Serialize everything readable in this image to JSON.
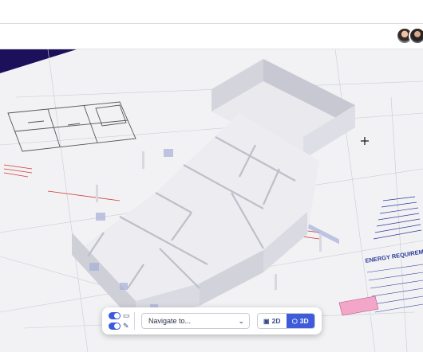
{
  "toolbar": {
    "navigate_placeholder": "Navigate to...",
    "view_2d_label": "2D",
    "view_3d_label": "3D",
    "active_view": "3D",
    "toggle_1_on": true,
    "toggle_2_on": true
  },
  "plan_text": {
    "energy_title": "ENERGY REQUIREMEN"
  },
  "colors": {
    "viewport_bg": "#1b1059",
    "accent": "#3f5bd9",
    "plan_red": "#d23a3a",
    "plan_blue": "#2a3a9a",
    "sticky_note": "#f4a6c8"
  },
  "icons": {
    "comment": "comment-icon",
    "measure": "measure-icon",
    "chevron": "chevron-down-icon",
    "plan2d": "floorplan-2d-icon",
    "cube3d": "cube-3d-icon",
    "move": "move-cursor-icon"
  }
}
